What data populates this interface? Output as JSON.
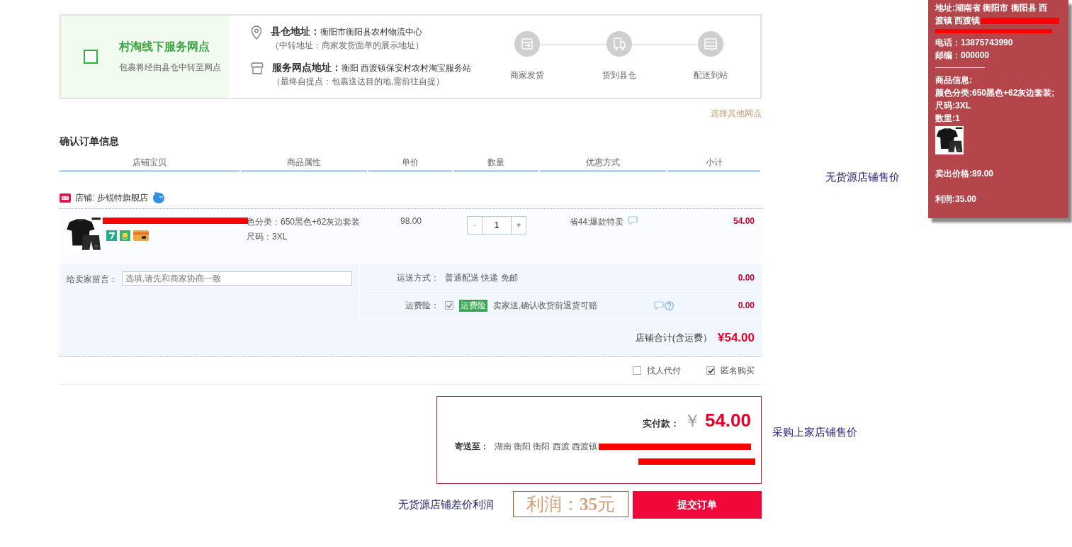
{
  "service_point": {
    "checked": false,
    "title": "村淘线下服务网点",
    "subtitle": "包裹将经由县仓中转至网点",
    "addresses": [
      {
        "kind": "warehouse",
        "label": "县仓地址：",
        "value": "衡阳市衡阳县农村物流中心",
        "note": "（中转地址：商家发货面单的展示地址）"
      },
      {
        "kind": "station",
        "label": "服务网点地址：",
        "value": "衡阳 西渡镇保安村农村淘宝服务站",
        "note": "（最终自提点：包裹送达目的地,需前往自提）"
      }
    ],
    "steps": [
      {
        "kind": "ship",
        "label": "商家发货"
      },
      {
        "kind": "truck",
        "label": "货到县仓"
      },
      {
        "kind": "store",
        "label": "配送到站"
      }
    ],
    "change_link": "选择其他网点"
  },
  "section_title": "确认订单信息",
  "table": {
    "columns": [
      "店铺宝贝",
      "商品属性",
      "单价",
      "数量",
      "优惠方式",
      "小计"
    ]
  },
  "shop": {
    "label": "店铺: 步锐特旗舰店"
  },
  "item": {
    "attributes": [
      "色分类：650黑色+62灰边套装",
      "尺码：3XL"
    ],
    "price": "98.00",
    "minus": "-",
    "quantity": "1",
    "plus": "+",
    "discount": "省44:爆款特卖",
    "subtotal": "54.00"
  },
  "message": {
    "label": "给卖家留言：",
    "placeholder": "选填,请先和商家协商一致"
  },
  "shipping": {
    "label": "运送方式：",
    "value": "普通配送 快递 免邮",
    "amount": "0.00"
  },
  "insurance": {
    "label": "运费险：",
    "checked": true,
    "tag": "运费险",
    "text": "卖家送,确认收货前退货可赔",
    "amount": "0.00"
  },
  "shop_total": {
    "label": "店铺合计(含运费）",
    "amount": "¥54.00"
  },
  "options": [
    {
      "label": "找人代付",
      "checked": false
    },
    {
      "label": "匿名购买",
      "checked": true
    }
  ],
  "payment": {
    "label": "实付款：",
    "currency": "￥",
    "amount": "54.00",
    "address_label": "寄送至：",
    "address": "湖南 衡阳 衡阳 西渡 西渡镇"
  },
  "profit": "利润：**35**元",
  "submit": "提交订单",
  "annotations": [
    {
      "text": "无货源店铺售价"
    },
    {
      "text": "采购上家店铺售价"
    },
    {
      "text": "无货源店铺差价利润"
    }
  ],
  "info_panel": {
    "address_lines": [
      "地址:湖南省 衡阳市 衡阳县 西",
      "渡镇 西渡镇"
    ],
    "phone": "电话：13875743990",
    "zip": "邮编：000000",
    "goods_title": "商品信息:",
    "goods": "颜色分类:650黑色+62灰边套装;尺码:3XL",
    "quantity": "数里:1",
    "sell_price": "卖出价格:89.00",
    "profit": "利润:35.00"
  }
}
